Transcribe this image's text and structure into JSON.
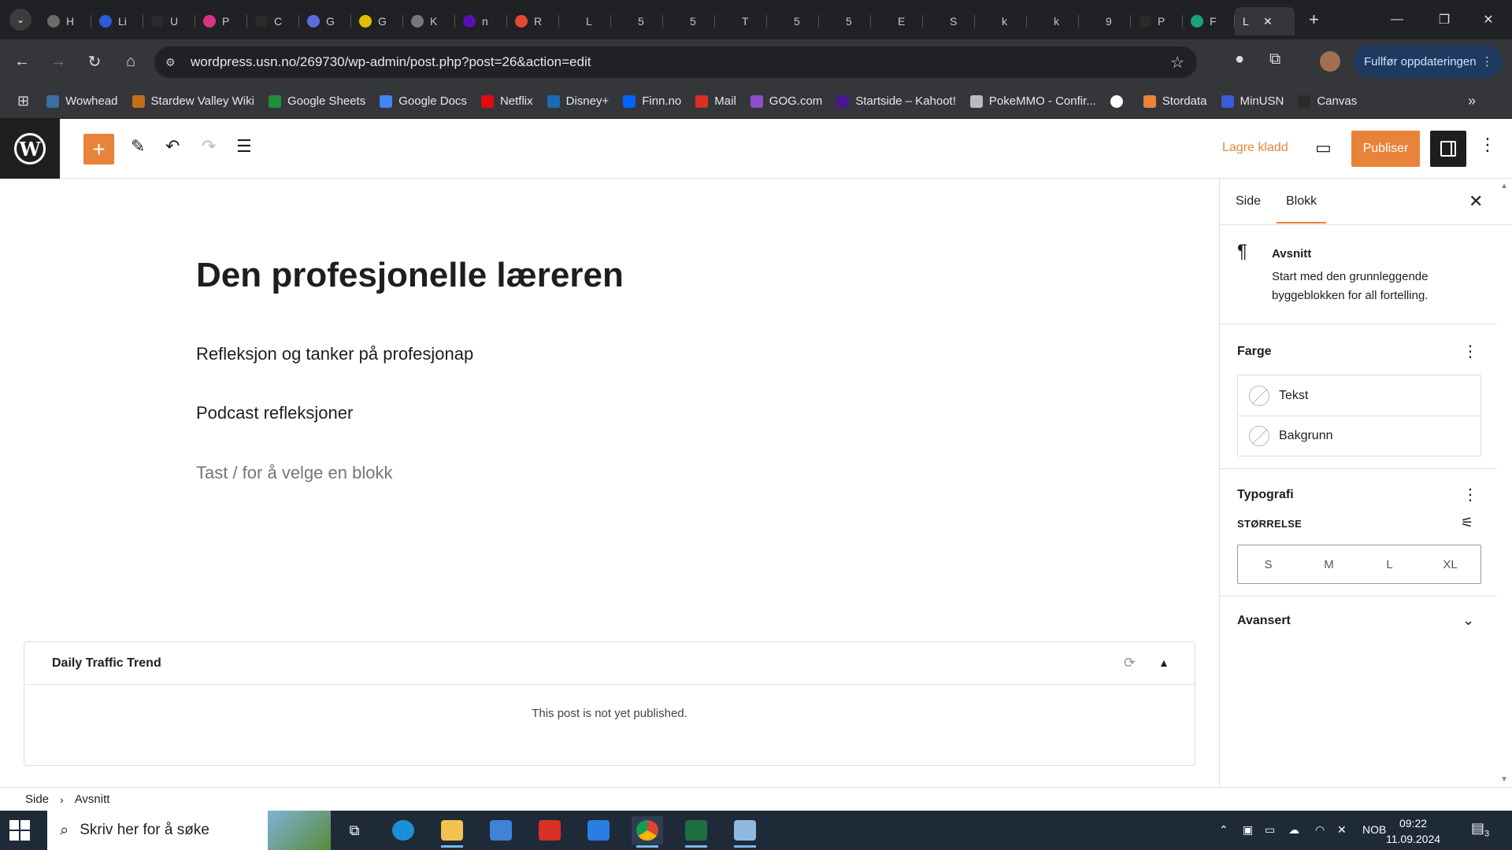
{
  "browser": {
    "tabs": [
      {
        "title": "H",
        "color": "#6b6b6b"
      },
      {
        "title": "Li",
        "color": "#2d5cd6"
      },
      {
        "title": "U",
        "color": "#2b2b2b"
      },
      {
        "title": "P",
        "color": "#d63384"
      },
      {
        "title": "C",
        "color": "#2b2b2b"
      },
      {
        "title": "G",
        "color": "#5a6de0"
      },
      {
        "title": "G",
        "color": "#e0c000"
      },
      {
        "title": "K",
        "color": "#777777"
      },
      {
        "title": "n",
        "color": "#5b0fb3"
      },
      {
        "title": "R",
        "color": "#e24a2f"
      },
      {
        "title": "L",
        "color": "#202124"
      },
      {
        "title": "5",
        "color": "#202124"
      },
      {
        "title": "5",
        "color": "#202124"
      },
      {
        "title": "T",
        "color": "#202124"
      },
      {
        "title": "5",
        "color": "#202124"
      },
      {
        "title": "5",
        "color": "#202124"
      },
      {
        "title": "E",
        "color": "#202124"
      },
      {
        "title": "S",
        "color": "#202124"
      },
      {
        "title": "k",
        "color": "#202124"
      },
      {
        "title": "k",
        "color": "#202124"
      },
      {
        "title": "9",
        "color": "#202124"
      },
      {
        "title": "P",
        "color": "#2b2b2b"
      },
      {
        "title": "F",
        "color": "#1aa37a"
      }
    ],
    "active_tab": {
      "title": "L",
      "close": "✕"
    },
    "new_tab": "+",
    "url": "wordpress.usn.no/269730/wp-admin/post.php?post=26&action=edit",
    "update_button": "Fullfør oppdateringen",
    "bookmarks": [
      {
        "label": "Wowhead",
        "color": "#3a6ea5"
      },
      {
        "label": "Stardew Valley Wiki",
        "color": "#c46d1a"
      },
      {
        "label": "Google Sheets",
        "color": "#1e8e3e"
      },
      {
        "label": "Google Docs",
        "color": "#4285f4"
      },
      {
        "label": "Netflix",
        "color": "#e50914"
      },
      {
        "label": "Disney+",
        "color": "#1a6bb3"
      },
      {
        "label": "Finn.no",
        "color": "#0063fb"
      },
      {
        "label": "Mail",
        "color": "#d93025"
      },
      {
        "label": "GOG.com",
        "color": "#8c4fc9"
      },
      {
        "label": "Startside – Kahoot!",
        "color": "#46178f"
      },
      {
        "label": "PokeMMO - Confir...",
        "color": "#bbbbbb"
      },
      {
        "label": "",
        "color": "#ffffff"
      },
      {
        "label": "Stordata",
        "color": "#e8833a"
      },
      {
        "label": "MinUSN",
        "color": "#3b5bdb"
      },
      {
        "label": "Canvas",
        "color": "#2b2b2b"
      }
    ]
  },
  "wp": {
    "save_draft": "Lagre kladd",
    "publish": "Publiser",
    "post_title": "Den profesjonelle læreren",
    "paragraphs": [
      "Refleksjon og tanker på profesjonap",
      "Podcast refleksjoner"
    ],
    "block_placeholder": "Tast / for å velge en blokk",
    "traffic": {
      "title": "Daily Traffic Trend",
      "message": "This post is not yet published."
    },
    "sidebar": {
      "tab_page": "Side",
      "tab_block": "Blokk",
      "block_name": "Avsnitt",
      "block_desc": "Start med den grunnleggende byggeblokken for all fortelling.",
      "color_title": "Farge",
      "color_text": "Tekst",
      "color_background": "Bakgrunn",
      "typography_title": "Typografi",
      "size_label": "STØRRELSE",
      "sizes": [
        "S",
        "M",
        "L",
        "XL"
      ],
      "advanced_title": "Avansert"
    },
    "breadcrumb": {
      "root": "Side",
      "current": "Avsnitt"
    },
    "accent_color": "#e8833a"
  },
  "taskbar": {
    "search_placeholder": "Skriv her for å søke",
    "language": "NOB",
    "time": "09:22",
    "date": "11.09.2024",
    "notifications": "3"
  }
}
